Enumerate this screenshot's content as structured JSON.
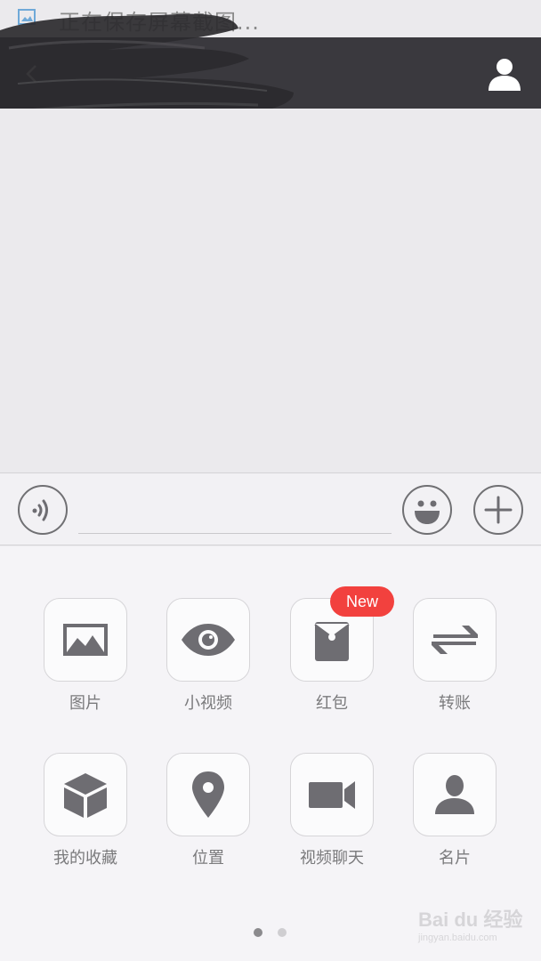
{
  "status_bar": {
    "text": "正在保存屏幕截图..."
  },
  "header": {
    "back_icon": "back-arrow-icon",
    "profile_icon": "person-icon"
  },
  "input_bar": {
    "voice_icon": "voice-icon",
    "text_value": "",
    "emoji_icon": "smiley-icon",
    "plus_icon": "plus-icon"
  },
  "panel": {
    "items": [
      {
        "label": "图片",
        "icon": "image-icon"
      },
      {
        "label": "小视频",
        "icon": "eye-icon"
      },
      {
        "label": "红包",
        "icon": "red-envelope-icon"
      },
      {
        "label": "转账",
        "icon": "transfer-icon"
      },
      {
        "label": "我的收藏",
        "icon": "cube-icon"
      },
      {
        "label": "位置",
        "icon": "location-pin-icon"
      },
      {
        "label": "视频聊天",
        "icon": "video-camera-icon"
      },
      {
        "label": "名片",
        "icon": "person-card-icon"
      }
    ],
    "badge": "New",
    "pages": 2,
    "current_page": 1
  },
  "watermark": {
    "main": "Bai du 经验",
    "sub": "jingyan.baidu.com"
  },
  "colors": {
    "header_bg": "#3a393e",
    "badge_bg": "#f2413e",
    "icon_gray": "#6e6d72",
    "background": "#ebeaed"
  }
}
